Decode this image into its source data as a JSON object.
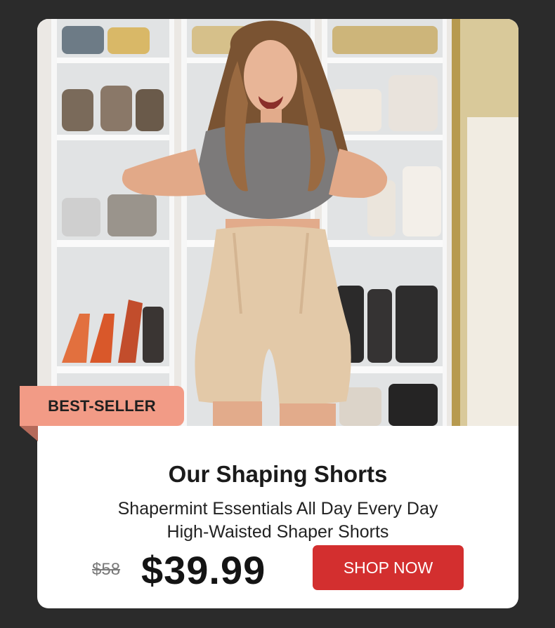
{
  "badge": {
    "label": "BEST-SELLER"
  },
  "product": {
    "title": "Our Shaping Shorts",
    "subtitle_line1": "Shapermint Essentials All Day Every Day",
    "subtitle_line2": "High-Waisted Shaper Shorts",
    "old_price": "$58",
    "price": "$39.99"
  },
  "cta": {
    "label": "SHOP NOW"
  },
  "colors": {
    "background": "#2b2b2b",
    "card": "#ffffff",
    "badge": "#f29b86",
    "cta": "#d32f2f"
  }
}
